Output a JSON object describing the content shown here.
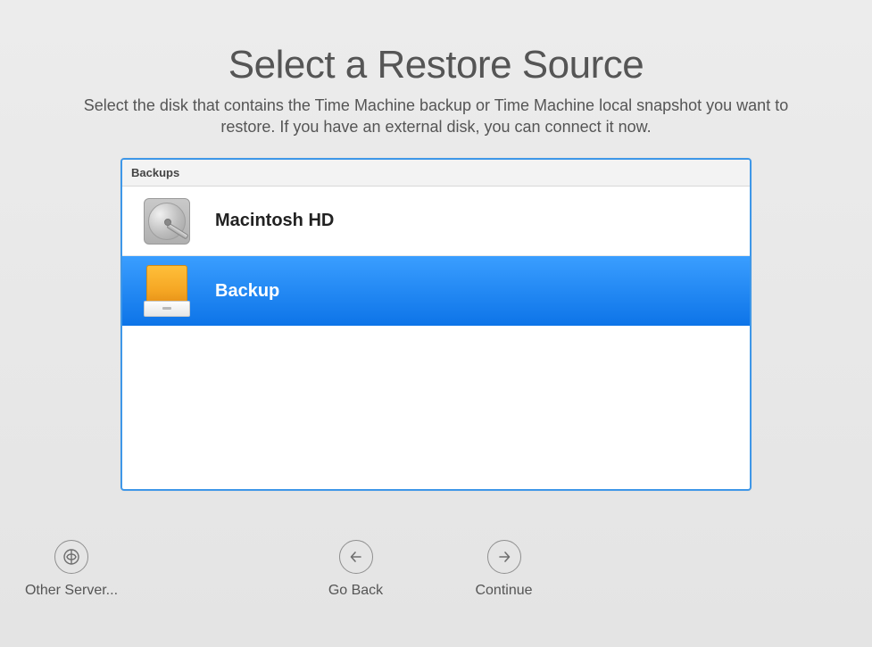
{
  "header": {
    "title": "Select a Restore Source",
    "subtitle": "Select the disk that contains the Time Machine backup or Time Machine local snapshot you want to restore. If you have an external disk, you can connect it now."
  },
  "panel": {
    "section_label": "Backups",
    "items": [
      {
        "label": "Macintosh HD",
        "icon": "internal-hdd",
        "selected": false
      },
      {
        "label": "Backup",
        "icon": "external-disk",
        "selected": true
      }
    ]
  },
  "footer": {
    "other_server": "Other Server...",
    "go_back": "Go Back",
    "continue": "Continue"
  }
}
